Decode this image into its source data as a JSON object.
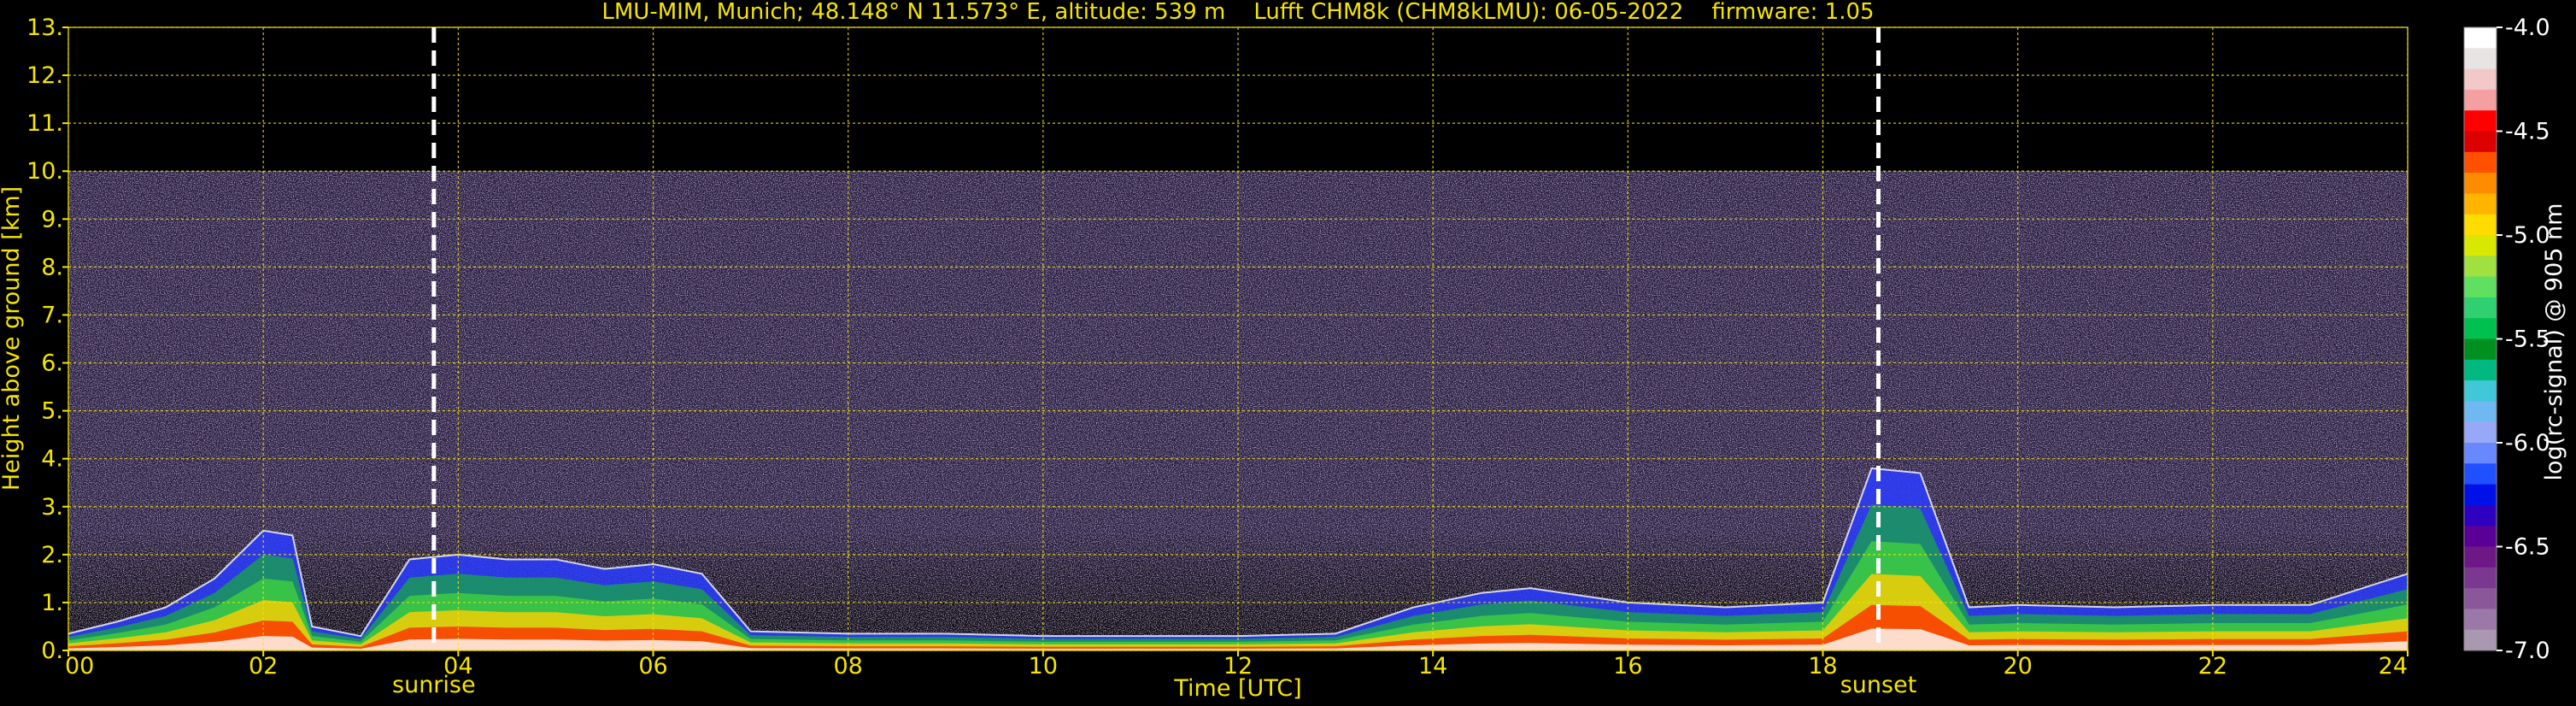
{
  "colors": {
    "background": "#000000",
    "text": "#f5e500",
    "grid": "#f5e500",
    "noise": "#8a70b8",
    "marker": "#ffffff"
  },
  "chart_data": {
    "type": "heatmap",
    "title": "LMU-MIM, Munich; 48.148° N 11.573° E, altitude: 539 m    Lufft CHM8k (CHM8kLMU): 06-05-2022    firmware: 1.05",
    "xlabel": "Time [UTC]",
    "ylabel": "Height above ground [km]",
    "xlim": [
      0,
      24
    ],
    "ylim": [
      0,
      13
    ],
    "x_ticks": [
      "00",
      "02",
      "04",
      "06",
      "08",
      "10",
      "12",
      "14",
      "16",
      "18",
      "20",
      "22",
      "24"
    ],
    "x_tick_values": [
      0,
      2,
      4,
      6,
      8,
      10,
      12,
      14,
      16,
      18,
      20,
      22,
      24
    ],
    "y_ticks": [
      "0.",
      "1.",
      "2.",
      "3.",
      "4.",
      "5.",
      "6.",
      "7.",
      "8.",
      "9.",
      "10.",
      "11.",
      "12.",
      "13."
    ],
    "y_tick_values": [
      0,
      1,
      2,
      3,
      4,
      5,
      6,
      7,
      8,
      9,
      10,
      11,
      12,
      13
    ],
    "grid": true,
    "signal_range_km": [
      0,
      10
    ],
    "markers": [
      {
        "label": "sunrise",
        "time": 3.75
      },
      {
        "label": "sunset",
        "time": 18.57
      }
    ],
    "colorbar": {
      "label": "log(rc-signal) @ 905 nm",
      "min": -7.0,
      "max": -4.0,
      "ticks": [
        "-4.0",
        "-4.5",
        "-5.0",
        "-5.5",
        "-6.0",
        "-6.5",
        "-7.0"
      ],
      "tick_values": [
        -4.0,
        -4.5,
        -5.0,
        -5.5,
        -6.0,
        -6.5,
        -7.0
      ],
      "colors": [
        "#ffffff",
        "#e8e4e4",
        "#f2c8c8",
        "#f4a0a0",
        "#ff0000",
        "#dc0000",
        "#ff5000",
        "#ff8c00",
        "#ffb400",
        "#ffdc00",
        "#d8e800",
        "#a0e040",
        "#60e060",
        "#30d070",
        "#00c050",
        "#009020",
        "#00b880",
        "#40c8d8",
        "#70b8f0",
        "#98a8f8",
        "#6888ff",
        "#2050ff",
        "#0010e8",
        "#3000c0",
        "#5a0098",
        "#6e1888",
        "#7a3890",
        "#8a5898",
        "#9a78a8",
        "#aa98b0"
      ]
    },
    "aerosol_layer_km": [
      {
        "t": 0.0,
        "h": 0.35
      },
      {
        "t": 0.5,
        "h": 0.6
      },
      {
        "t": 1.0,
        "h": 0.9
      },
      {
        "t": 1.5,
        "h": 1.5
      },
      {
        "t": 2.0,
        "h": 2.5
      },
      {
        "t": 2.3,
        "h": 2.4
      },
      {
        "t": 2.5,
        "h": 0.5
      },
      {
        "t": 3.0,
        "h": 0.3
      },
      {
        "t": 3.5,
        "h": 1.9
      },
      {
        "t": 4.0,
        "h": 2.0
      },
      {
        "t": 4.5,
        "h": 1.9
      },
      {
        "t": 5.0,
        "h": 1.9
      },
      {
        "t": 5.5,
        "h": 1.7
      },
      {
        "t": 6.0,
        "h": 1.8
      },
      {
        "t": 6.5,
        "h": 1.6
      },
      {
        "t": 7.0,
        "h": 0.4
      },
      {
        "t": 8.0,
        "h": 0.35
      },
      {
        "t": 9.0,
        "h": 0.35
      },
      {
        "t": 10.0,
        "h": 0.3
      },
      {
        "t": 11.0,
        "h": 0.3
      },
      {
        "t": 12.0,
        "h": 0.3
      },
      {
        "t": 13.0,
        "h": 0.35
      },
      {
        "t": 13.8,
        "h": 0.9
      },
      {
        "t": 14.5,
        "h": 1.2
      },
      {
        "t": 15.0,
        "h": 1.3
      },
      {
        "t": 16.0,
        "h": 1.0
      },
      {
        "t": 17.0,
        "h": 0.9
      },
      {
        "t": 18.0,
        "h": 1.0
      },
      {
        "t": 18.5,
        "h": 3.8
      },
      {
        "t": 19.0,
        "h": 3.7
      },
      {
        "t": 19.5,
        "h": 0.9
      },
      {
        "t": 20.0,
        "h": 0.95
      },
      {
        "t": 21.0,
        "h": 0.9
      },
      {
        "t": 22.0,
        "h": 0.95
      },
      {
        "t": 23.0,
        "h": 0.95
      },
      {
        "t": 24.0,
        "h": 1.6
      }
    ]
  }
}
